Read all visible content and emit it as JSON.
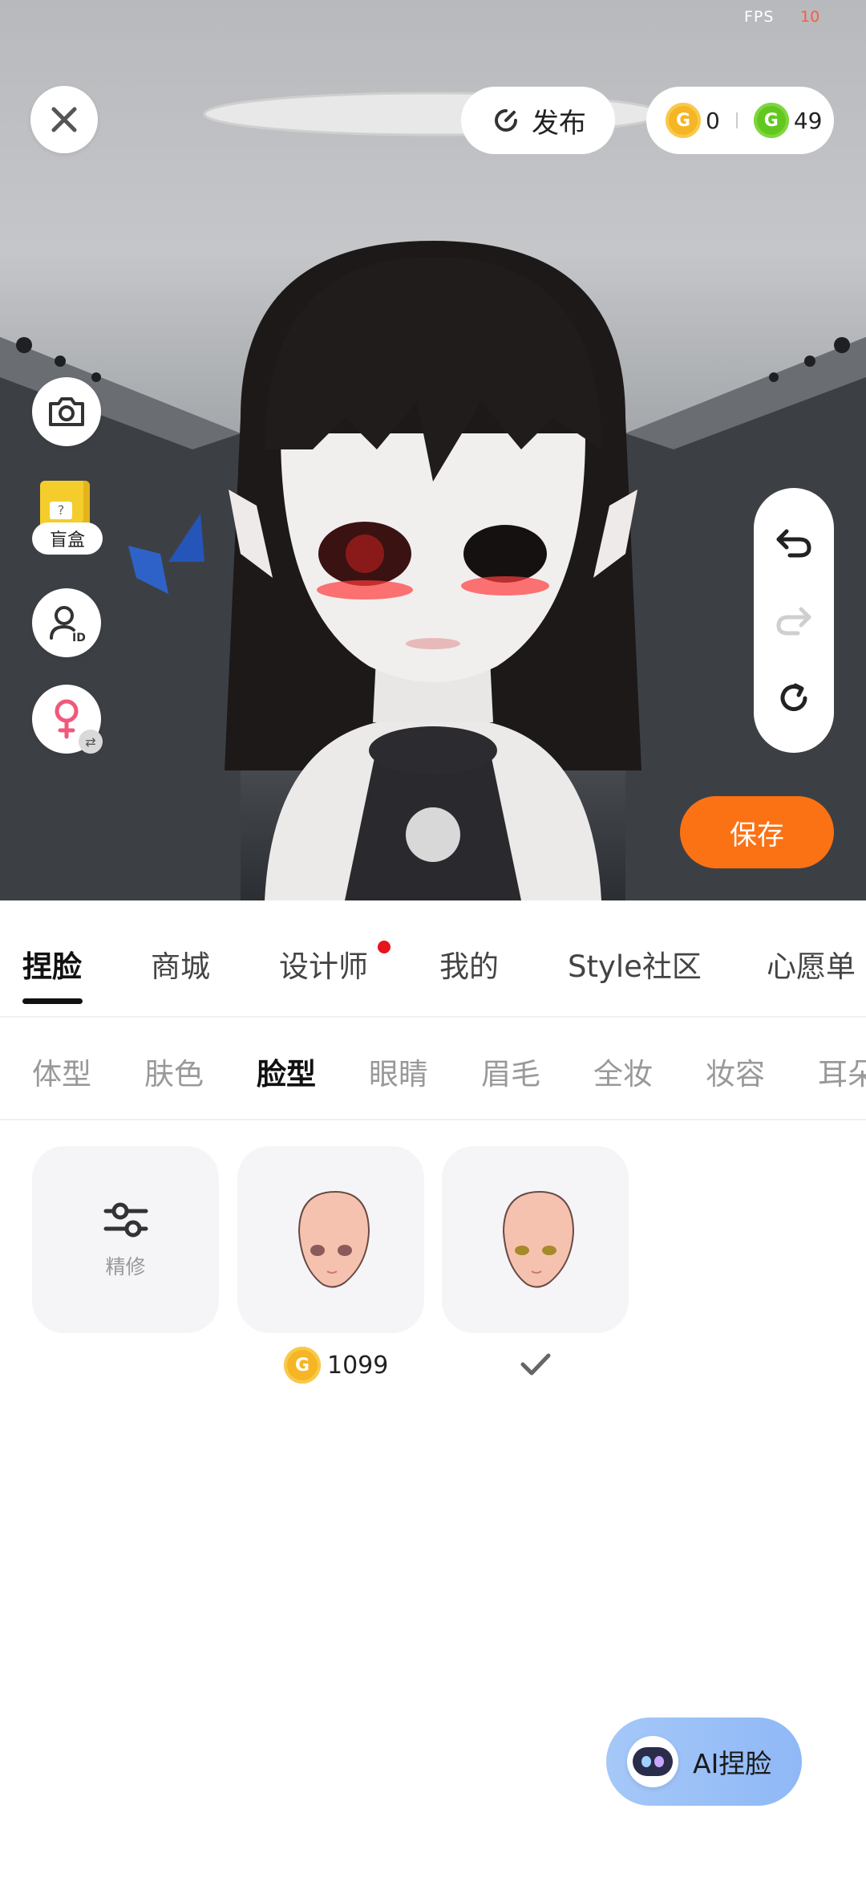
{
  "status": {
    "fps_label": "FPS",
    "fps_value": "10"
  },
  "topbar": {
    "publish_label": "发布",
    "gold_coin_count": "0",
    "green_coin_count": "49",
    "icons": [
      "close-icon",
      "refresh-arrow-icon",
      "gold-coin-icon",
      "green-coin-icon"
    ]
  },
  "left_tools": {
    "blindbox_label": "盲盒",
    "icons": [
      "camera-icon",
      "blind-box-icon",
      "avatar-id-icon",
      "female-gender-icon",
      "swap-icon"
    ]
  },
  "history": {
    "icons": [
      "undo-icon",
      "redo-icon",
      "reset-icon"
    ]
  },
  "save_label": "保存",
  "main_tabs": [
    {
      "label": "捏脸",
      "active": true
    },
    {
      "label": "商城",
      "active": false
    },
    {
      "label": "设计师",
      "active": false,
      "badge": true
    },
    {
      "label": "我的",
      "active": false
    },
    {
      "label": "Style社区",
      "active": false
    },
    {
      "label": "心愿单",
      "active": false
    }
  ],
  "sub_tabs": [
    {
      "label": "体型",
      "active": false
    },
    {
      "label": "肤色",
      "active": false
    },
    {
      "label": "脸型",
      "active": true
    },
    {
      "label": "眼睛",
      "active": false
    },
    {
      "label": "眉毛",
      "active": false
    },
    {
      "label": "全妆",
      "active": false
    },
    {
      "label": "妆容",
      "active": false
    },
    {
      "label": "耳朵",
      "active": false
    }
  ],
  "items": {
    "fine_tune_label": "精修",
    "face1_price": "1099",
    "face2_selected": true
  },
  "ai_button_label": "AI捏脸",
  "colors": {
    "accent_orange": "#fb7215",
    "badge_red": "#e8141c",
    "gold": "#f5b524",
    "green": "#62c81f"
  }
}
